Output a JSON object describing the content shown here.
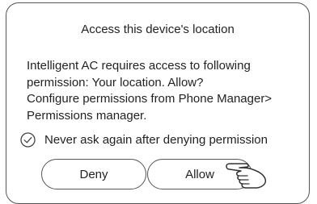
{
  "dialog": {
    "title": "Access this device's location",
    "body_lines": [
      "Intelligent AC requires access to following",
      "permission: Your location. Allow?",
      "Configure permissions from Phone Manager>",
      "Permissions manager."
    ],
    "checkbox_label": "Never ask again after denying permission",
    "deny_label": "Deny",
    "allow_label": "Allow",
    "pointer_icon": "pointing-hand-icon",
    "checkbox_icon": "check-circle-icon"
  }
}
